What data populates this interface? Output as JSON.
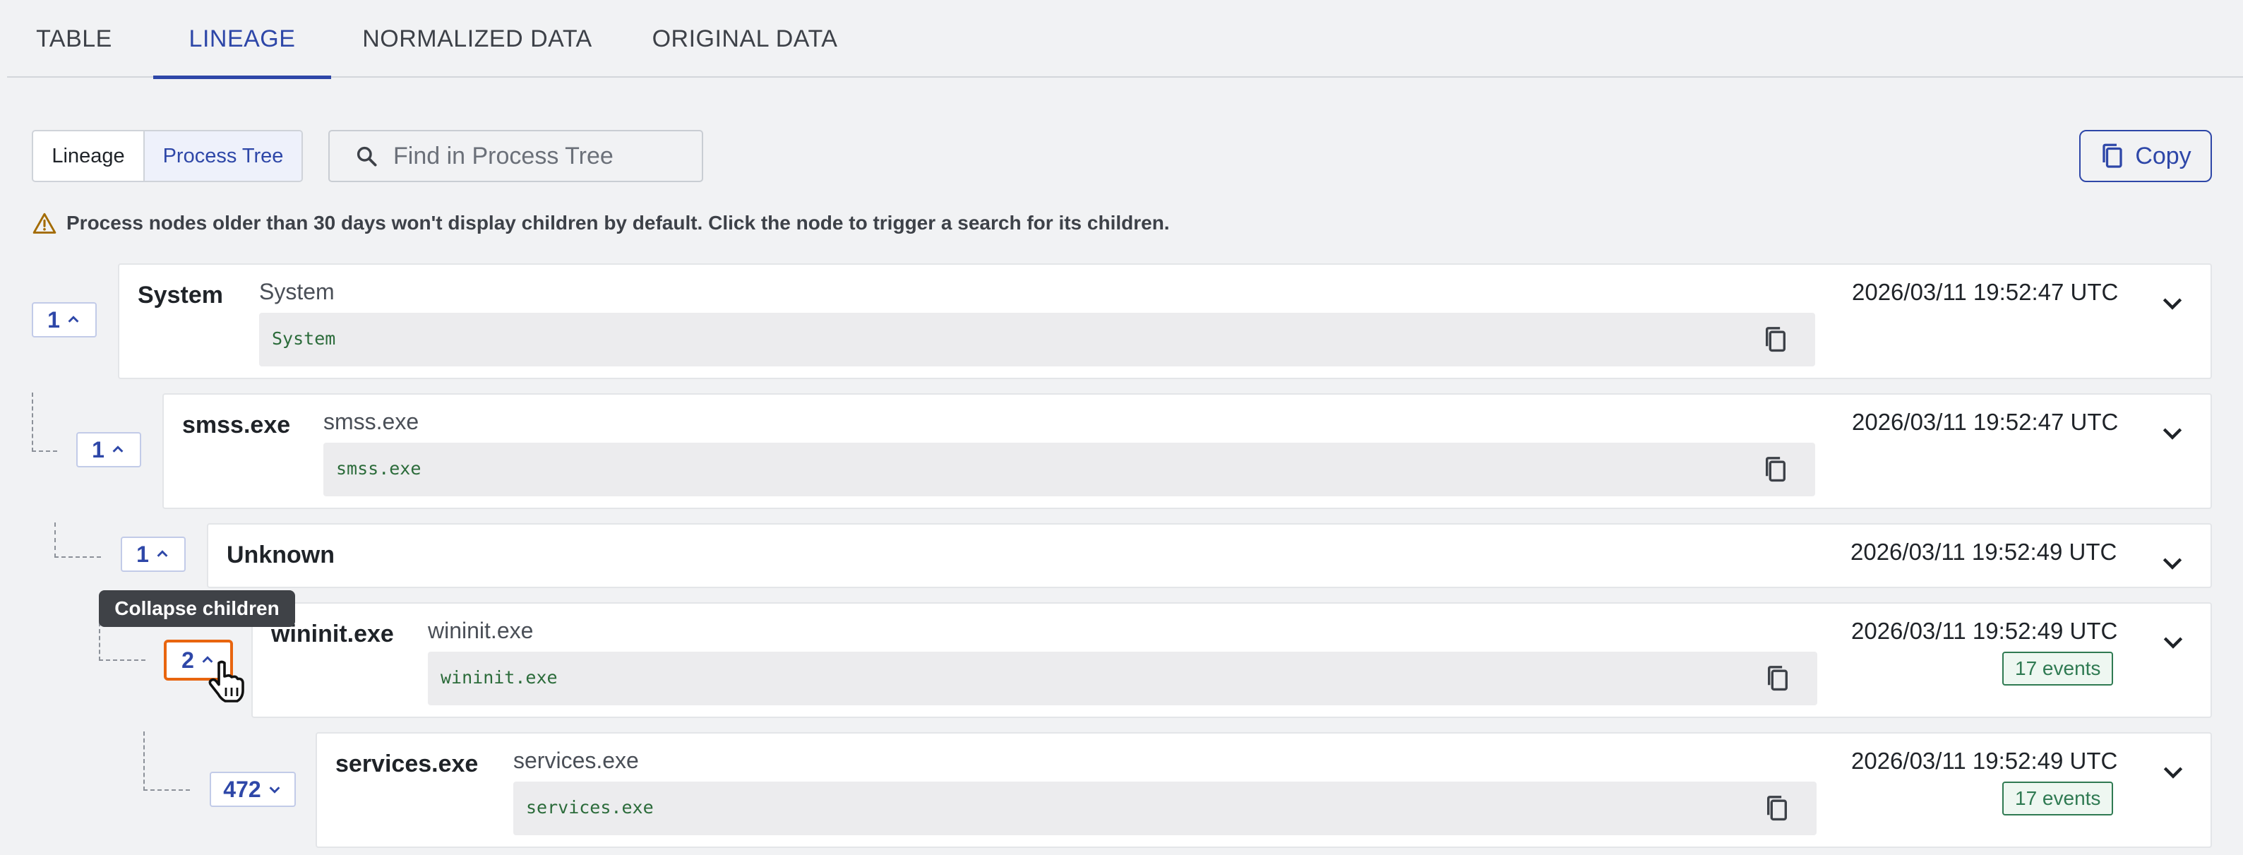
{
  "tabs": [
    {
      "label": "TABLE"
    },
    {
      "label": "LINEAGE",
      "active": true
    },
    {
      "label": "NORMALIZED DATA"
    },
    {
      "label": "ORIGINAL DATA"
    }
  ],
  "toolbar": {
    "view_toggle": [
      "Lineage",
      "Process Tree"
    ],
    "selected_view": "Process Tree",
    "search_placeholder": "Find in Process Tree",
    "copy_label": "Copy"
  },
  "warning": {
    "icon": "warning-icon",
    "text": "Process nodes older than 30 days won't display children by default. Click the node to trigger a search for its children."
  },
  "tooltip": "Collapse children",
  "nodes": [
    {
      "count": "1",
      "expanded": true,
      "name": "System",
      "subname": "System",
      "path": "System",
      "timestamp": "2026/03/11 19:52:47 UTC"
    },
    {
      "count": "1",
      "expanded": true,
      "name": "smss.exe",
      "subname": "smss.exe",
      "path": "smss.exe",
      "timestamp": "2026/03/11 19:52:47 UTC"
    },
    {
      "count": "1",
      "expanded": true,
      "name": "Unknown",
      "timestamp": "2026/03/11 19:52:49 UTC"
    },
    {
      "count": "2",
      "expanded": true,
      "name": "wininit.exe",
      "subname": "wininit.exe",
      "path": "wininit.exe",
      "timestamp": "2026/03/11 19:52:49 UTC",
      "events": "17 events"
    },
    {
      "count": "472",
      "expanded": false,
      "name": "services.exe",
      "subname": "services.exe",
      "path": "services.exe",
      "timestamp": "2026/03/11 19:52:49 UTC",
      "events": "17 events"
    }
  ],
  "colors": {
    "accent": "#2e47a8",
    "focus": "#e8650f",
    "events": "#2f7a52"
  }
}
